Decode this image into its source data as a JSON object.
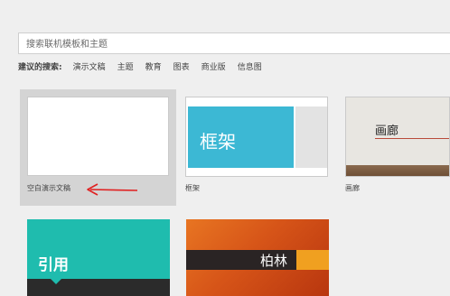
{
  "search": {
    "placeholder": "搜索联机模板和主题"
  },
  "suggestions": {
    "label": "建议的搜索:",
    "keywords": [
      "演示文稿",
      "主题",
      "教育",
      "图表",
      "商业版",
      "信息图"
    ]
  },
  "templates": [
    {
      "label": "空白演示文稿",
      "selected": true
    },
    {
      "label": "框架",
      "title": "框架"
    },
    {
      "label": "画廊",
      "title": "画廊"
    },
    {
      "title": "引用"
    },
    {
      "title": "柏林"
    }
  ],
  "colors": {
    "accent_arrow": "#e02020",
    "frame_band": "#3cb8d4",
    "quote_teal": "#1fbcae",
    "berlin_orange": "#d65418"
  }
}
